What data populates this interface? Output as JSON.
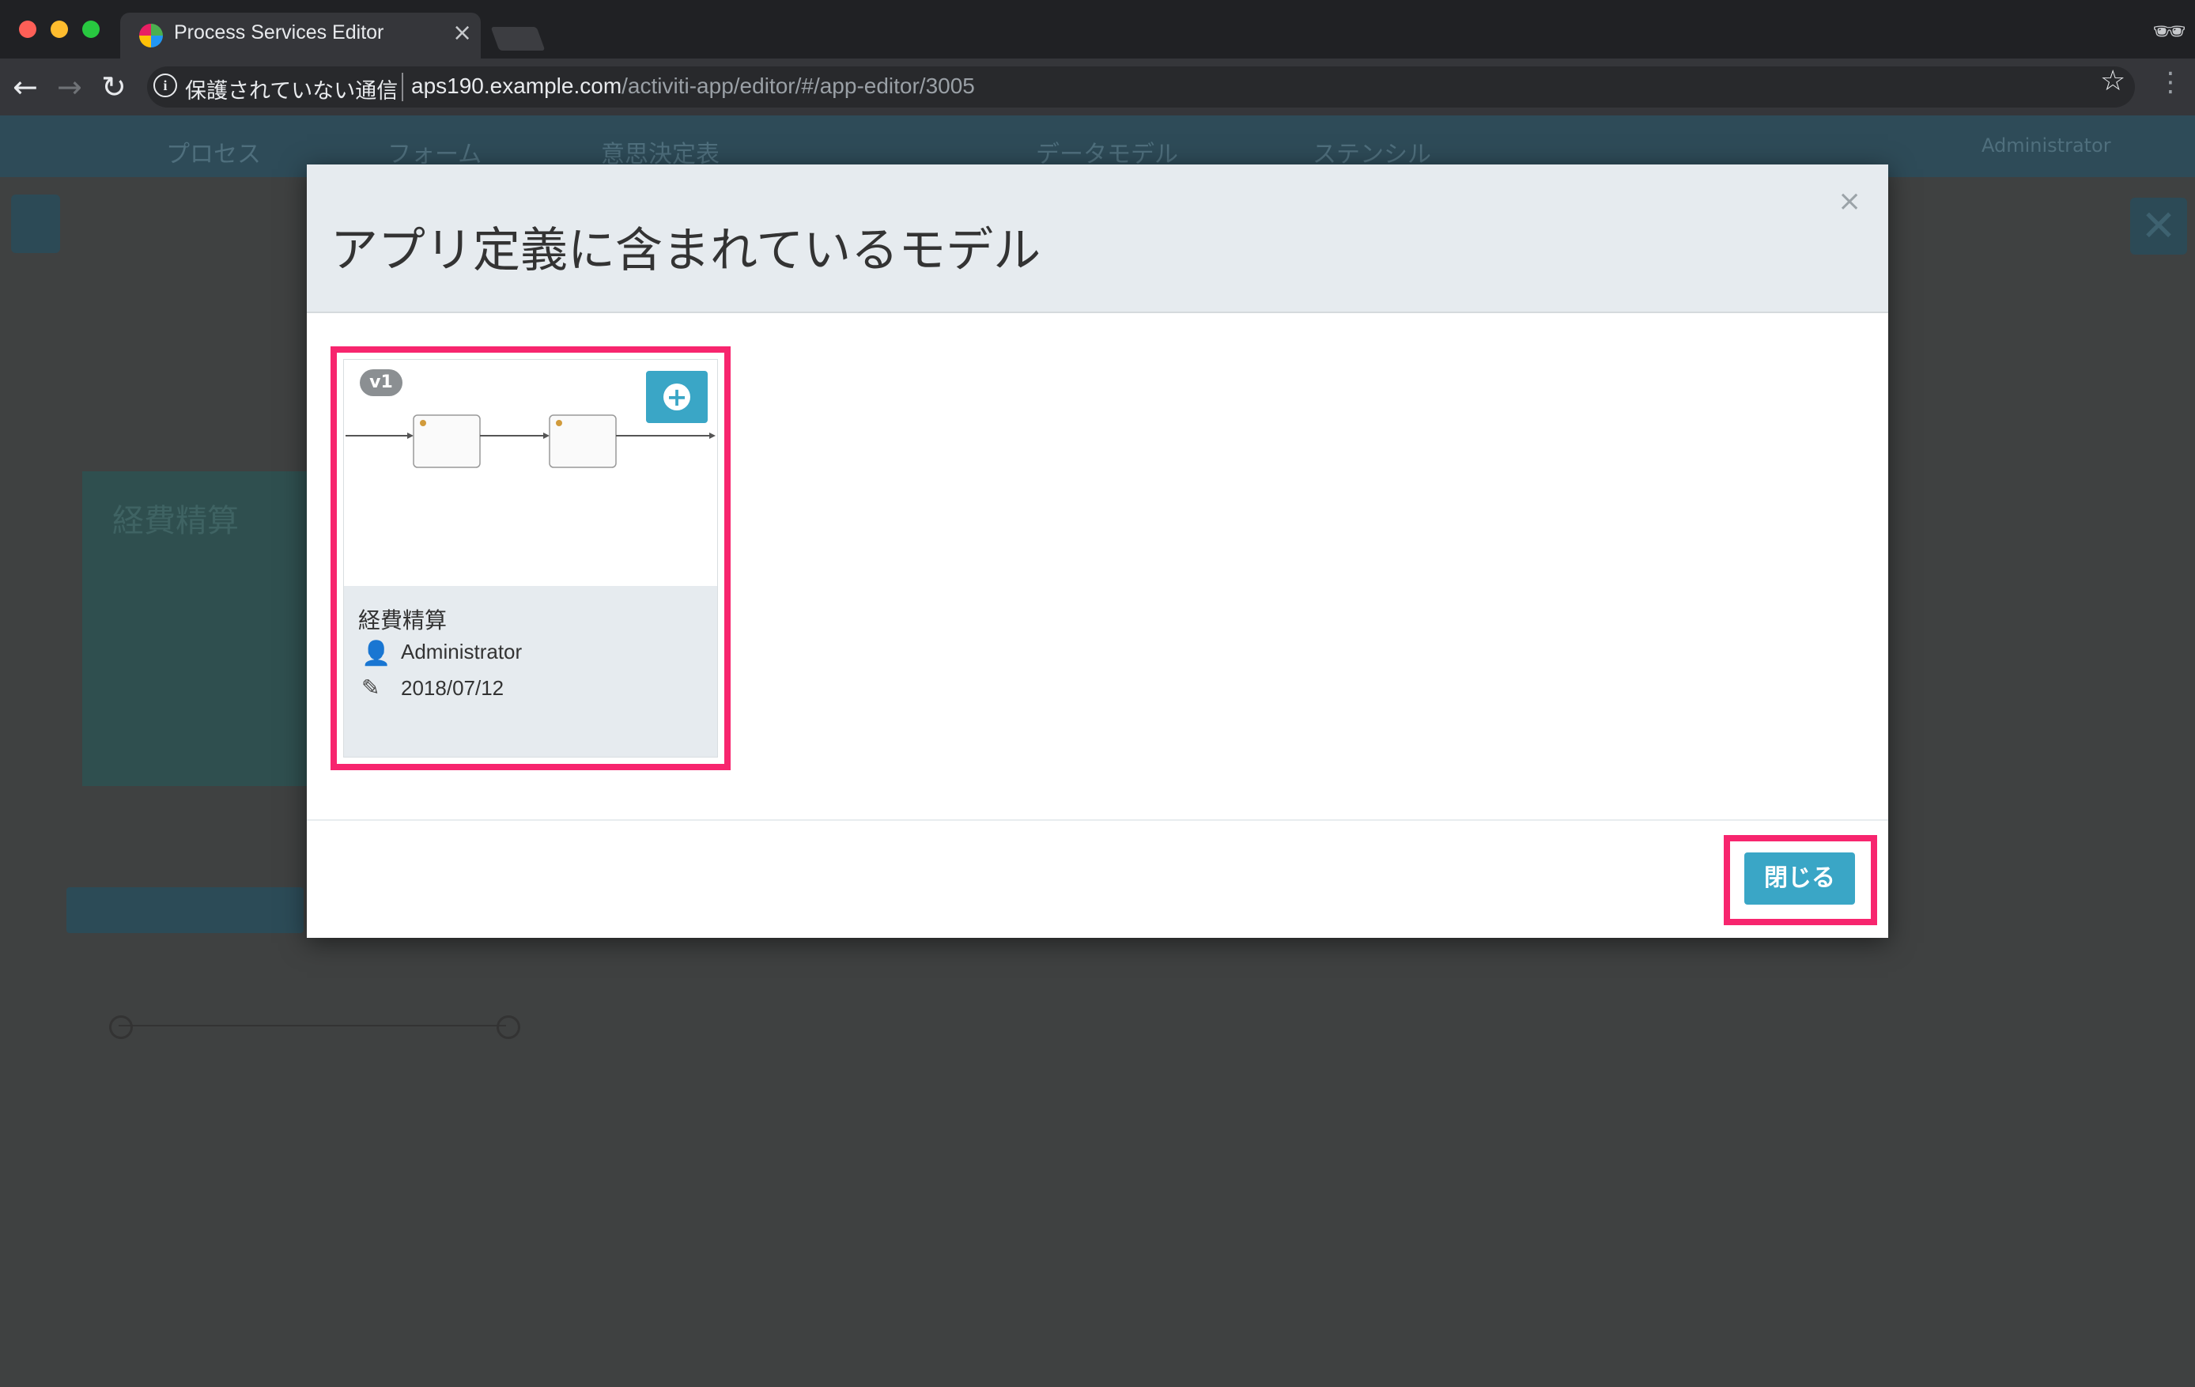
{
  "browser": {
    "tab_title": "Process Services Editor",
    "security_label": "保護されていない通信",
    "url_host": "aps190.example.com",
    "url_path": "/activiti-app/editor/#/app-editor/3005"
  },
  "background_app": {
    "nav_items": [
      "プロセス",
      "フォーム",
      "意思決定表",
      "データモデル",
      "ステンシル"
    ],
    "user": "Administrator"
  },
  "modal": {
    "title": "アプリ定義に含まれているモデル",
    "close_symbol": "×",
    "close_button_label": "閉じる",
    "model_card": {
      "version": "v1",
      "name": "経費精算",
      "owner": "Administrator",
      "modified_date": "2018/07/12"
    }
  },
  "colors": {
    "accent": "#3aa6c6",
    "highlight": "#f7256e"
  }
}
